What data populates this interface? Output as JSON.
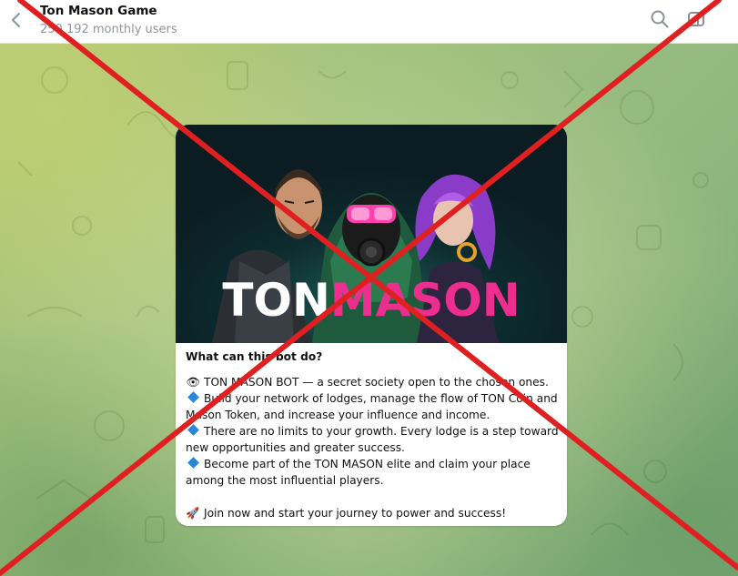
{
  "header": {
    "title": "Ton Mason Game",
    "subtitle": "250 192 monthly users"
  },
  "card": {
    "banner": {
      "logo_part1": "TON",
      "logo_part2": "MASON"
    },
    "heading": "What can this bot do?",
    "lines": [
      "TON MASON BOT — a secret society open to the chosen ones.",
      "Build your network of lodges, manage the flow of TON Coin and",
      "Mason Token, and increase your influence and income.",
      "There are no limits to your growth. Every lodge is a step toward",
      "new opportunities and greater success.",
      "Become part of the TON MASON elite and claim your place",
      "among the most influential players.",
      "Join now and start your journey to power and success!"
    ]
  },
  "colors": {
    "accent_pink": "#ec2f8f",
    "cross_red": "#e02020",
    "bullet_blue": "#2a86d8"
  },
  "icons": {
    "back": "arrow-left-icon",
    "search": "search-icon",
    "sidebar": "sidebar-toggle-icon",
    "line1": "eye-icon",
    "bullet": "blue-diamond-icon",
    "final": "rocket-icon"
  }
}
